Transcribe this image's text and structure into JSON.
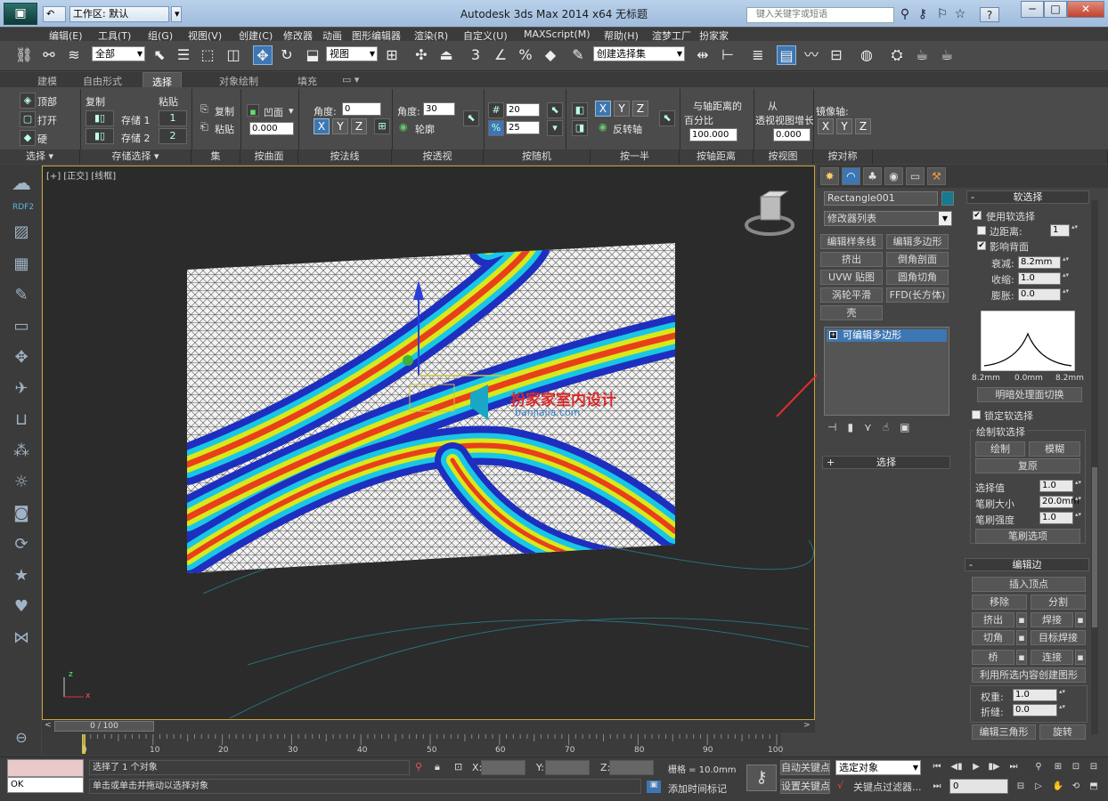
{
  "titlebar": {
    "workspace_label": "工作区: 默认",
    "title": "Autodesk 3ds Max  2014 x64     无标题",
    "search_placeholder": "键入关键字或短语",
    "help_label": "?",
    "min_label": "─",
    "max_label": "□",
    "close_label": "✕",
    "undo_label": "↶"
  },
  "menu": [
    "编辑(E)",
    "工具(T)",
    "组(G)",
    "视图(V)",
    "创建(C)",
    "修改器",
    "动画",
    "图形编辑器",
    "渲染(R)",
    "自定义(U)",
    "MAXScript(M)",
    "帮助(H)",
    "渲梦工厂",
    "扮家家"
  ],
  "toolbar": {
    "filter_value": "全部",
    "refcoord_value": "视图",
    "selset_value": "创建选择集",
    "snap_label": "3",
    "angle_label": "∠",
    "percent_label": "%",
    "spin_label": "◆"
  },
  "ribbon": {
    "tabs": [
      "建模",
      "自由形式",
      "选择",
      "对象绘制",
      "填充"
    ],
    "active_tab": "选择",
    "select": {
      "top": "顶部",
      "open": "打开",
      "hard": "硬"
    },
    "storage": {
      "copy": "复制",
      "store1": "存储 1",
      "store2": "存储 2",
      "paste": "粘贴"
    },
    "set": {
      "copy": "复制",
      "paste": "粘贴"
    },
    "surface": {
      "concave": "凹面",
      "value": "0.000"
    },
    "normal": {
      "angle_label": "角度:",
      "angle_value": "0",
      "x": "X",
      "y": "Y",
      "z": "Z"
    },
    "persp": {
      "angle_label": "角度:",
      "angle_value": "30",
      "outline": "轮廓"
    },
    "random": {
      "value1": "20",
      "value2": "25",
      "hash": "#",
      "percent": "%"
    },
    "half": {
      "x": "X",
      "y": "Y",
      "z": "Z",
      "flip": "反转轴"
    },
    "pivot": {
      "label1": "与轴距离的",
      "label2": "百分比",
      "value": "100.000"
    },
    "viewgrow": {
      "label1": "从",
      "label2": "透视视图增长",
      "value": "0.000"
    },
    "symmetry": {
      "label": "镜像轴:",
      "x": "X",
      "y": "Y",
      "z": "Z"
    },
    "groups": [
      "选择 ▾",
      "存储选择 ▾",
      "集",
      "按曲面",
      "按法线",
      "按透视",
      "按随机",
      "按一半",
      "按轴距离",
      "按视图",
      "按对称"
    ]
  },
  "leftbar": {
    "label": "RDF2"
  },
  "viewport": {
    "label": "[+] [正交] [线框]",
    "watermark1": "扮家家室内设计",
    "watermark2": "banjiajia.com",
    "axis_x": "x",
    "axis_y": "y",
    "axis_z": "z"
  },
  "cmdpanel": {
    "tabs": [
      "✸",
      "◠",
      "♣",
      "◉",
      "▭",
      "⚒"
    ],
    "object_name": "Rectangle001",
    "modifier_list": "修改器列表",
    "buttons": [
      "编辑样条线",
      "编辑多边形",
      "挤出",
      "倒角剖面",
      "UVW 贴图",
      "圆角切角",
      "涡轮平滑",
      "FFD(长方体)",
      "壳"
    ],
    "stack_item": "可编辑多边形",
    "selection_rollout": "选择",
    "soft": {
      "title": "软选择",
      "use_soft": "使用软选择",
      "edge_dist": "边距离:",
      "edge_value": "1",
      "affect_back": "影响背面",
      "falloff": "衰减:",
      "falloff_value": "8.2mm",
      "pinch": "收缩:",
      "pinch_value": "1.0",
      "bubble": "膨胀:",
      "bubble_value": "0.0",
      "curve_left": "8.2mm",
      "curve_mid": "0.0mm",
      "curve_right": "8.2mm",
      "shaded_face": "明暗处理面切换",
      "lock": "锁定软选择",
      "paint_group": "绘制软选择",
      "paint": "绘制",
      "blur": "模糊",
      "revert": "复原",
      "sel_value": "选择值",
      "sel_value_v": "1.0",
      "brush_size": "笔刷大小",
      "brush_size_v": "20.0mm",
      "brush_strength": "笔刷强度",
      "brush_strength_v": "1.0",
      "brush_options": "笔刷选项"
    },
    "edit_edges": {
      "title": "编辑边",
      "insert_vertex": "插入顶点",
      "remove": "移除",
      "split": "分割",
      "extrude": "挤出",
      "weld": "焊接",
      "chamfer": "切角",
      "target_weld": "目标焊接",
      "bridge": "桥",
      "connect": "连接",
      "create_shape": "利用所选内容创建图形",
      "weight": "权重:",
      "weight_v": "1.0",
      "crease": "折缝:",
      "crease_v": "0.0",
      "edit_tri": "编辑三角形",
      "turn": "旋转"
    }
  },
  "timeline": {
    "frame": "0 / 100",
    "ticks": [
      "0",
      "10",
      "20",
      "30",
      "40",
      "50",
      "60",
      "70",
      "80",
      "90",
      "100"
    ]
  },
  "status": {
    "ok": "OK",
    "selected": "选择了 1 个对象",
    "prompt": "单击或单击并拖动以选择对象",
    "x_label": "X:",
    "y_label": "Y:",
    "z_label": "Z:",
    "grid": "栅格 = 10.0mm",
    "add_tag": "添加时间标记",
    "autokey": "自动关键点",
    "setkey": "设置关键点",
    "selected_obj": "选定对象",
    "key_filter": "关键点过滤器...",
    "frame_value": "0"
  }
}
